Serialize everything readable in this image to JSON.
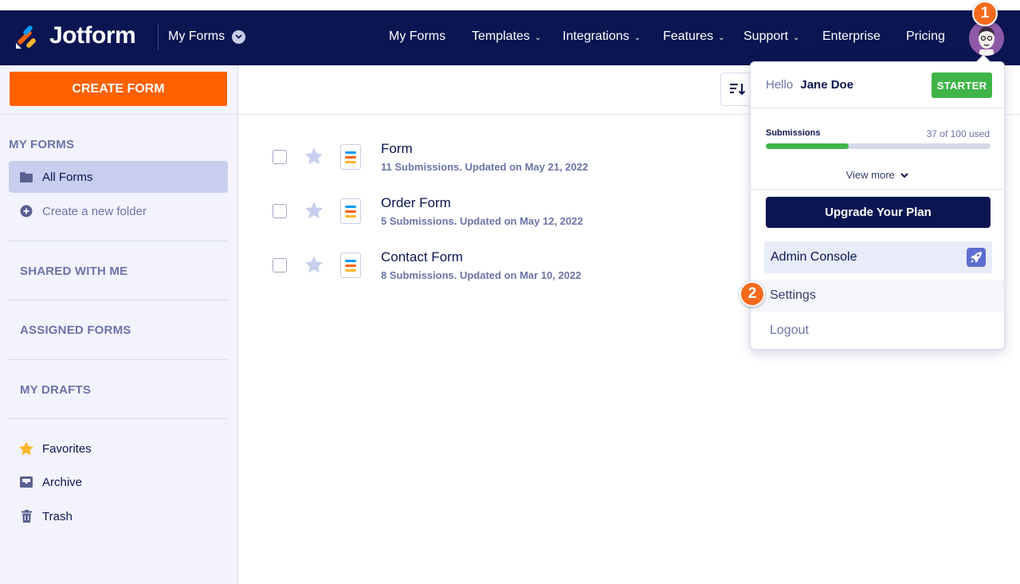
{
  "colors": {
    "navy": "#0a1551",
    "orange": "#ff6100",
    "green": "#3fb549",
    "sidebar_bg": "#f3f3fe",
    "active_item": "#c8ceed",
    "muted_text": "#6c73a8",
    "badge_orange": "#f56a1c"
  },
  "navbar": {
    "brand": "Jotform",
    "switcher_label": "My Forms",
    "links": [
      {
        "label": "My Forms",
        "has_caret": false,
        "icon": ""
      },
      {
        "label": "Templates",
        "has_caret": true,
        "icon": "chevron-down-icon"
      },
      {
        "label": "Integrations",
        "has_caret": true,
        "icon": "chevron-down-icon"
      },
      {
        "label": "Features",
        "has_caret": true,
        "icon": "chevron-down-icon"
      },
      {
        "label": "Support",
        "has_caret": true,
        "icon": "chevron-down-icon"
      },
      {
        "label": "Enterprise",
        "has_caret": false,
        "icon": ""
      },
      {
        "label": "Pricing",
        "has_caret": false,
        "icon": ""
      }
    ]
  },
  "callouts": {
    "one": "1",
    "two": "2"
  },
  "sidebar": {
    "create_button": "CREATE FORM",
    "my_forms_heading": "MY FORMS",
    "items": {
      "all_forms": "All Forms",
      "create_folder": "Create a new folder"
    },
    "sections": {
      "shared": "SHARED WITH ME",
      "assigned": "ASSIGNED FORMS",
      "drafts": "MY DRAFTS"
    },
    "bottom": {
      "favorites": "Favorites",
      "archive": "Archive",
      "trash": "Trash"
    }
  },
  "forms": [
    {
      "title": "Form",
      "meta": "11 Submissions. Updated on May 21, 2022"
    },
    {
      "title": "Order Form",
      "meta": "5 Submissions. Updated on May 12, 2022"
    },
    {
      "title": "Contact Form",
      "meta": "8 Submissions. Updated on Mar 10, 2022"
    }
  ],
  "account_menu": {
    "greeting": "Hello",
    "user_name": "Jane Doe",
    "plan_badge": "STARTER",
    "submissions_label": "Submissions",
    "submissions_count": "37 of 100 used",
    "usage_fraction": 0.37,
    "view_more": "View more",
    "upgrade_button": "Upgrade Your Plan",
    "admin_console": "Admin Console",
    "settings": "Settings",
    "logout": "Logout"
  }
}
